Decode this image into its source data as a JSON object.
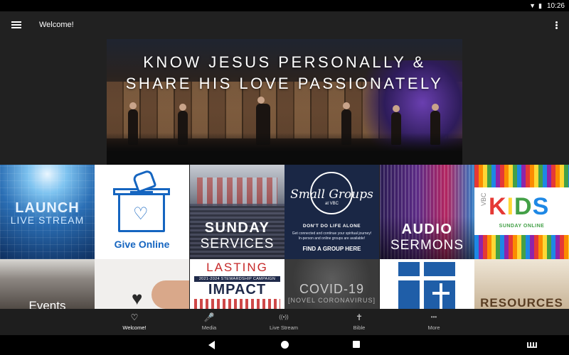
{
  "status_bar": {
    "time": "10:26",
    "wifi_icon": "wifi-icon",
    "battery_icon": "battery-icon"
  },
  "app_bar": {
    "title": "Welcome!",
    "menu_icon": "hamburger-menu-icon",
    "overflow_icon": "more-vert-icon"
  },
  "hero": {
    "line1": "KNOW JESUS PERSONALLY &",
    "line2": "SHARE HIS LOVE PASSIONATELY"
  },
  "tiles": {
    "launch": {
      "line1": "LAUNCH",
      "line2": "LIVE STREAM"
    },
    "give": {
      "label": "Give Online"
    },
    "sunday": {
      "line1": "SUNDAY",
      "line2": "SERVICES"
    },
    "small_groups": {
      "title": "Small Groups",
      "sub": "at VBC",
      "tag": "DON'T DO LIFE ALONE",
      "desc": "Get connected and continue your spiritual journey! In-person and online groups are available!",
      "cta": "FIND A GROUP HERE"
    },
    "audio": {
      "line1": "AUDIO",
      "line2": "SERMONS"
    },
    "kids": {
      "vbc": "VBC",
      "k1": "K",
      "k2": "I",
      "k3": "D",
      "k4": "S",
      "sub": "SUNDAY ONLINE"
    },
    "events": {
      "label": "Events"
    },
    "lasting": {
      "line1": "LASTING",
      "band": "2021-2024 STEWARDSHIP CAMPAIGN",
      "line2": "IMPACT"
    },
    "covid": {
      "line1": "COVID-19",
      "line2": "[NOVEL CORONAVIRUS]"
    },
    "resources": {
      "label": "RESOURCES"
    }
  },
  "bottom_nav": {
    "items": [
      {
        "label": "Welcome!",
        "icon": "heart-icon",
        "glyph": "♡"
      },
      {
        "label": "Media",
        "icon": "microphone-icon",
        "glyph": "🎤"
      },
      {
        "label": "Live Stream",
        "icon": "broadcast-icon",
        "glyph": "((•))"
      },
      {
        "label": "Bible",
        "icon": "bible-icon",
        "glyph": "✝"
      },
      {
        "label": "More",
        "icon": "more-horiz-icon",
        "glyph": "•••"
      }
    ]
  },
  "colors": {
    "app_bg": "#212121",
    "brand_blue": "#1565c0"
  }
}
